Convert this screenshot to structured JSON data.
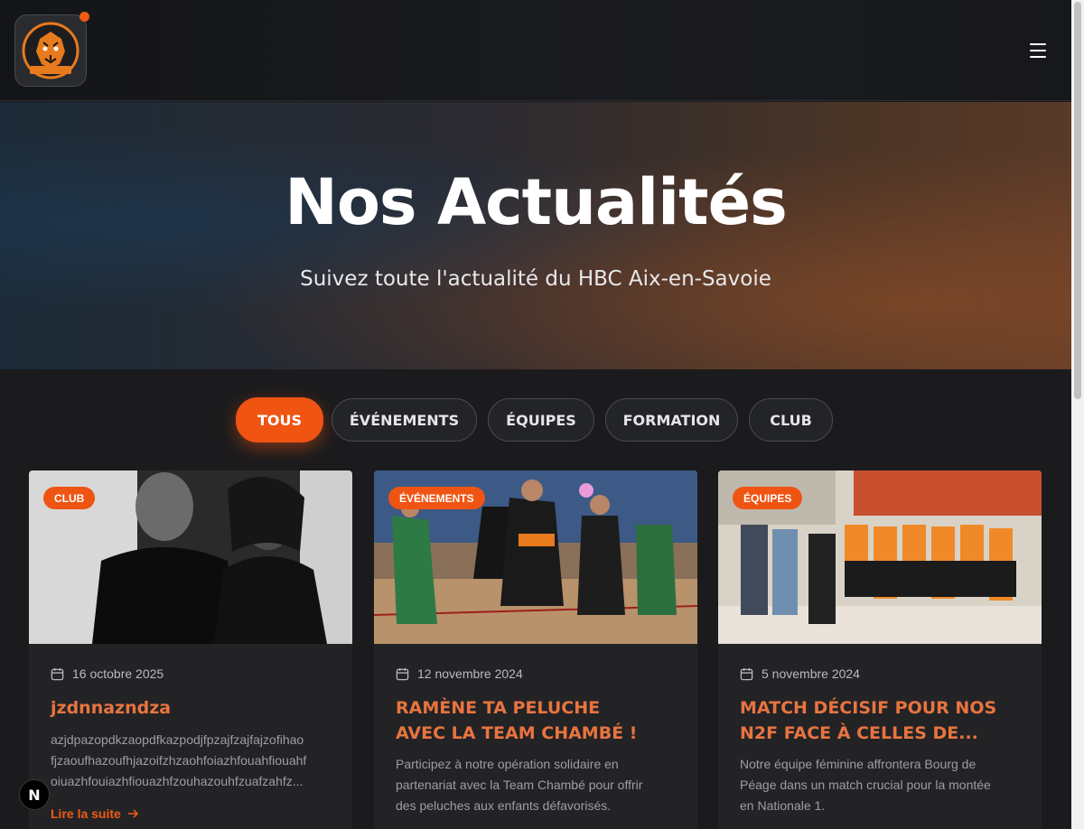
{
  "header": {
    "logo_alt": "HBC Aix-en-Savoie logo",
    "menu_icon": "hamburger-menu-icon",
    "notification_color": "#ef5a14"
  },
  "hero": {
    "title": "Nos Actualités",
    "subtitle": "Suivez toute l'actualité du HBC Aix-en-Savoie"
  },
  "filters": {
    "active": "TOUS",
    "items": [
      "TOUS",
      "ÉVÉNEMENTS",
      "ÉQUIPES",
      "FORMATION",
      "CLUB"
    ]
  },
  "colors": {
    "accent": "#ef5413",
    "title_orange": "#e8743f",
    "background": "#1b1b1d"
  },
  "articles": [
    {
      "category": "CLUB",
      "date": "16 octobre 2025",
      "title": "jzdnnazndza",
      "excerpt_line1": "azjdpazopdkzaopdfkazpodjfpzajfzajfajzofihao",
      "excerpt_line2": "fjzaoufhazoufhjazoifzhzaohfoiazhfouahfiouahf",
      "excerpt_line3": "oiuazhfouiazhfiouazhfzouhazouhfzuafzahfz...",
      "read_more": "Lire la suite"
    },
    {
      "category": "ÉVÉNEMENTS",
      "date": "12 novembre 2024",
      "title_line1": "RAMÈNE TA PELUCHE",
      "title_line2": "AVEC LA TEAM CHAMBÉ !",
      "excerpt_line1": "Participez à notre opération solidaire en",
      "excerpt_line2": "partenariat avec la Team Chambé pour offrir",
      "excerpt_line3": "des peluches aux enfants défavorisés."
    },
    {
      "category": "ÉQUIPES",
      "date": "5 novembre 2024",
      "title_line1": "MATCH DÉCISIF POUR NOS",
      "title_line2": "N2F FACE À CELLES DE...",
      "excerpt_line1": "Notre équipe féminine affrontera Bourg de",
      "excerpt_line2": "Péage dans un match crucial pour la montée",
      "excerpt_line3": "en Nationale 1."
    }
  ],
  "dev_badge": "N"
}
